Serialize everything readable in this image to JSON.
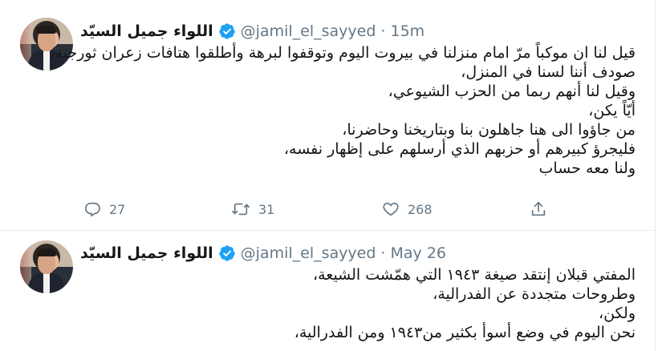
{
  "tweets": [
    {
      "display_name": "اللواء جميل السيّد",
      "handle_time": "@jamil_el_sayyed · 15m",
      "lines": [
        "قيل لنا ان موكباً مرّ امام منزلنا في بيروت اليوم وتوقفوا لبرهة وأطلقوا هتافات زعران ثورجية،",
        "صودف أننا لسنا في المنزل،",
        "وقيل لنا أنهم ربما من الحزب الشيوعي،",
        "أيّاً يكن،",
        "من جاؤوا الى هنا جاهلون بنا وبتاريخنا وحاضرنا،",
        "فليجرؤ كبيرهم أو حزبهم الذي أرسلهم على إظهار نفسه،",
        "ولنا معه  حساب"
      ],
      "replies": "27",
      "retweets": "31",
      "likes": "268"
    },
    {
      "display_name": "اللواء جميل السيّد",
      "handle_time": "@jamil_el_sayyed · May 26",
      "lines": [
        "المفتي قبلان إنتقد صيغة ١٩٤٣ التي همّشت الشيعة،",
        "وطروحات متجددة عن الفدرالية،",
        "ولكن،",
        "نحن اليوم في وضع أسوأ بكثير من١٩٤٣ ومن الفدرالية،"
      ]
    }
  ],
  "icons": {
    "verified": "verified-badge-icon",
    "reply": "reply-icon",
    "retweet": "retweet-icon",
    "like": "heart-icon",
    "share": "share-icon"
  },
  "colors": {
    "verified": "#1da1f2",
    "secondary_text": "#657786",
    "primary_text": "#14171a"
  }
}
